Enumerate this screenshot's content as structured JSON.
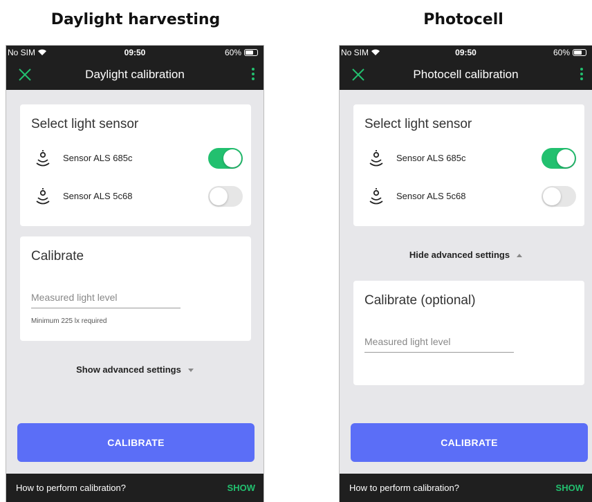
{
  "headings": {
    "left": "Daylight harvesting",
    "right": "Photocell"
  },
  "left": {
    "status": {
      "carrier": "No SIM",
      "time": "09:50",
      "battery": "60%"
    },
    "appbar": {
      "title": "Daylight calibration"
    },
    "sensor_card": {
      "title": "Select light sensor",
      "sensors": [
        {
          "label": "Sensor ALS 685c",
          "on": true
        },
        {
          "label": "Sensor ALS 5c68",
          "on": false
        }
      ]
    },
    "calibrate_card": {
      "title": "Calibrate",
      "placeholder": "Measured light level",
      "helper": "Minimum 225 lx required"
    },
    "advanced_link": "Show advanced settings",
    "button": "CALIBRATE",
    "bottombar": {
      "question": "How to perform calibration?",
      "action": "SHOW"
    }
  },
  "right": {
    "status": {
      "carrier": "No SIM",
      "time": "09:50",
      "battery": "60%"
    },
    "appbar": {
      "title": "Photocell calibration"
    },
    "sensor_card": {
      "title": "Select light sensor",
      "sensors": [
        {
          "label": "Sensor ALS 685c",
          "on": true
        },
        {
          "label": "Sensor ALS 5c68",
          "on": false
        }
      ]
    },
    "advanced_link": "Hide advanced settings",
    "calibrate_card": {
      "title": "Calibrate (optional)",
      "placeholder": "Measured light level"
    },
    "button": "CALIBRATE",
    "bottombar": {
      "question": "How to perform calibration?",
      "action": "SHOW"
    }
  },
  "colors": {
    "accent_green": "#22c06f",
    "button_blue": "#5b6ef7",
    "bar_dark": "#1f1f1f",
    "background": "#e7e7ea"
  }
}
